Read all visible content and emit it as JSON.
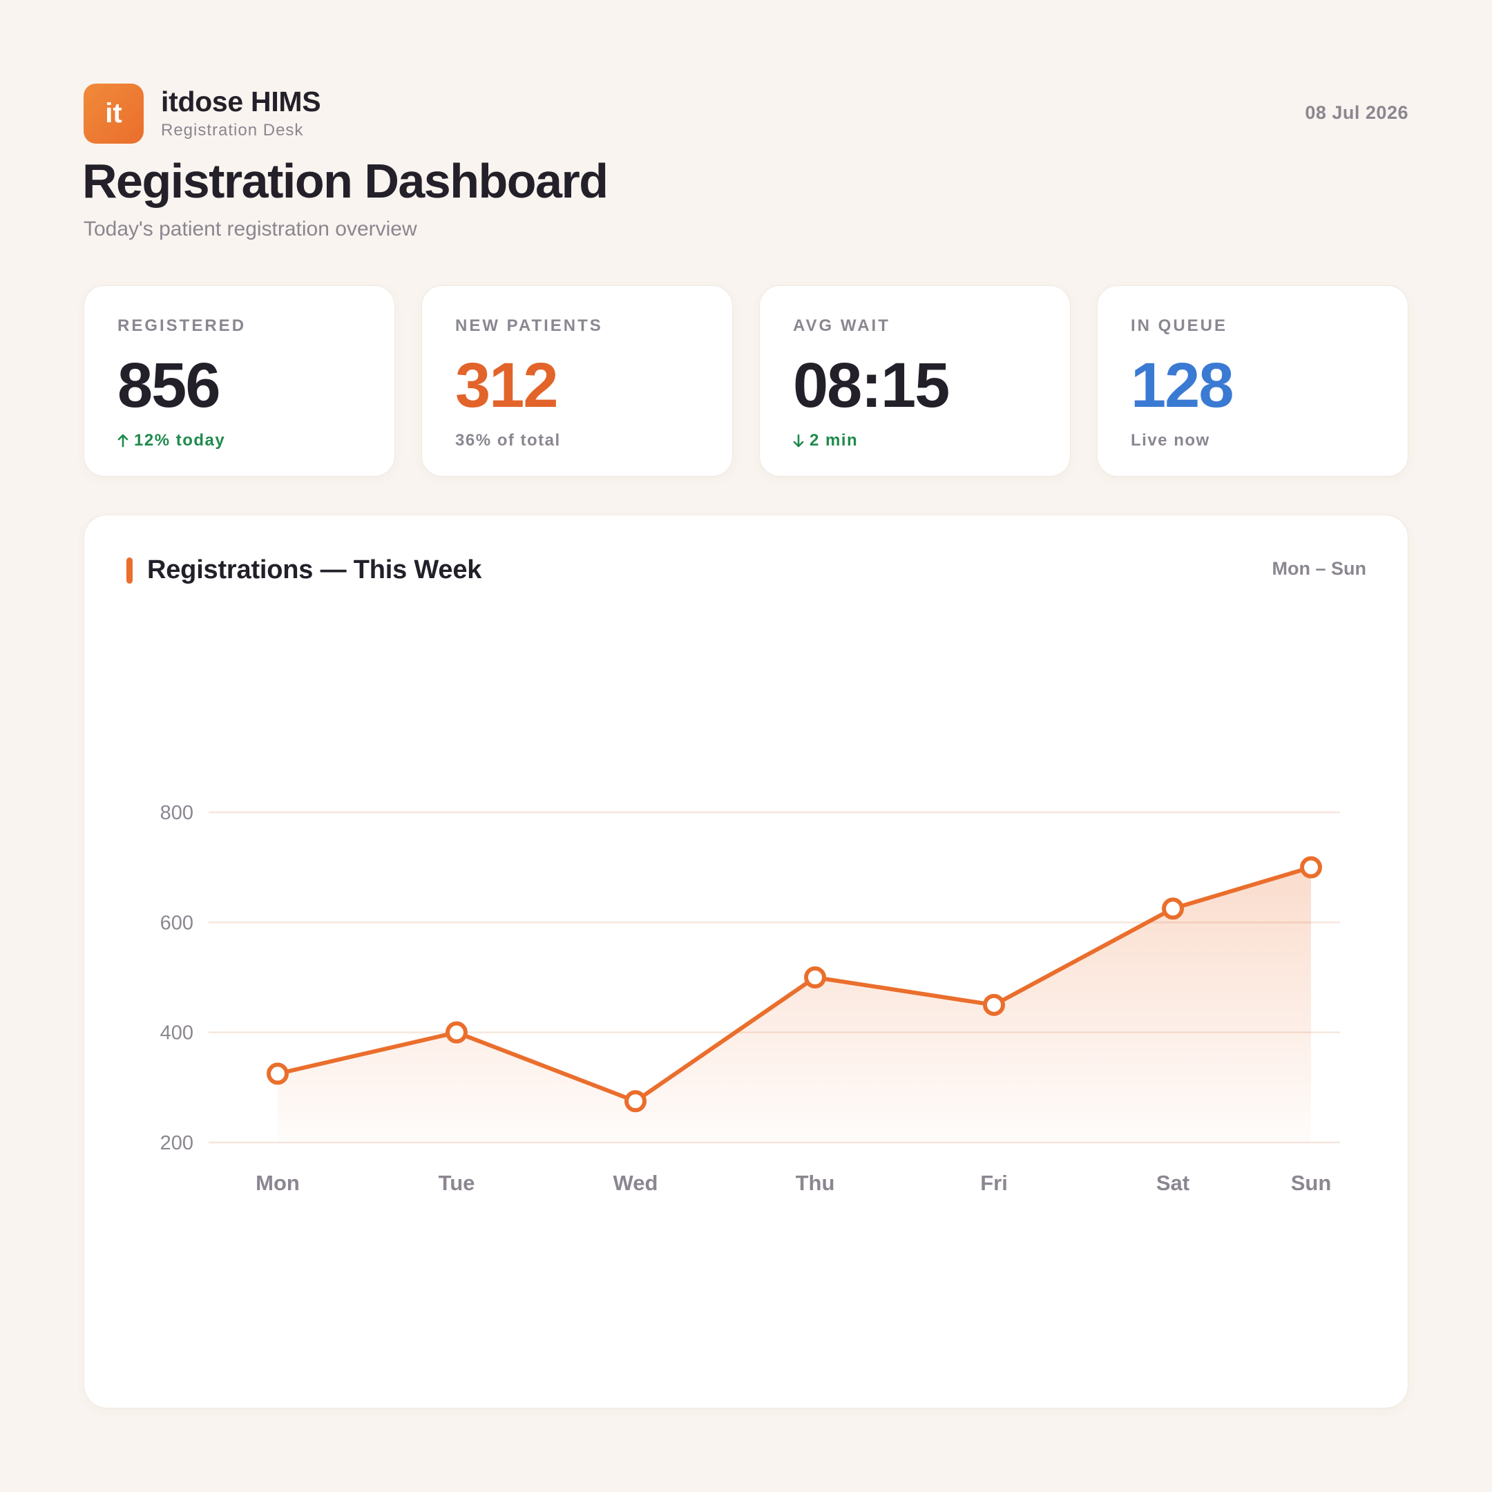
{
  "brand": {
    "logo_text": "it",
    "name": "itdose HIMS",
    "subtitle": "Registration Desk"
  },
  "date": "08 Jul 2026",
  "page": {
    "title": "Registration Dashboard",
    "subtitle": "Today's patient registration overview"
  },
  "stats": [
    {
      "label": "REGISTERED",
      "value": "856",
      "foot": "12% today",
      "foot_icon": "arrow-up-icon",
      "accent": "#23202a"
    },
    {
      "label": "NEW PATIENTS",
      "value": "312",
      "foot": "36% of total",
      "accent": "#e2642a"
    },
    {
      "label": "AVG WAIT",
      "value": "08:15",
      "foot": "2 min",
      "foot_icon": "arrow-down-icon",
      "accent": "#23202a"
    },
    {
      "label": "IN QUEUE",
      "value": "128",
      "foot": "Live now",
      "accent": "#3a7ad3"
    }
  ],
  "chart": {
    "title": "Registrations — This Week",
    "range": "Mon – Sun"
  },
  "chart_data": {
    "type": "area",
    "categories": [
      "Mon",
      "Tue",
      "Wed",
      "Thu",
      "Fri",
      "Sat",
      "Sun"
    ],
    "values": [
      325,
      400,
      275,
      500,
      450,
      625,
      700
    ],
    "yticks": [
      200,
      400,
      600,
      800
    ],
    "ylim": [
      200,
      800
    ],
    "grid": true,
    "color": "#ea6e2c"
  }
}
